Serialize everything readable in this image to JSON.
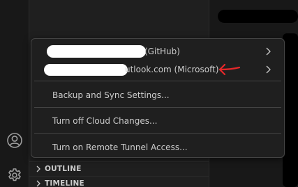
{
  "accounts_menu": {
    "accounts": [
      {
        "label": "(GitHub)"
      },
      {
        "label": "utlook.com (Microsoft)"
      }
    ],
    "actions": [
      {
        "label": "Backup and Sync Settings..."
      },
      {
        "label": "Turn off Cloud Changes..."
      },
      {
        "label": "Turn on Remote Tunnel Access..."
      }
    ]
  },
  "sidebar": {
    "sections": [
      {
        "label": "OUTLINE"
      },
      {
        "label": "TIMELINE"
      }
    ]
  },
  "activity_bar": {
    "icons": [
      "accounts-icon",
      "manage-gear-icon"
    ]
  },
  "colors": {
    "menu_bg": "#1f1f1f",
    "menu_border": "#454545",
    "menu_text": "#cccccc",
    "annotation_arrow": "#e5282a",
    "redaction": "#ffffff"
  }
}
